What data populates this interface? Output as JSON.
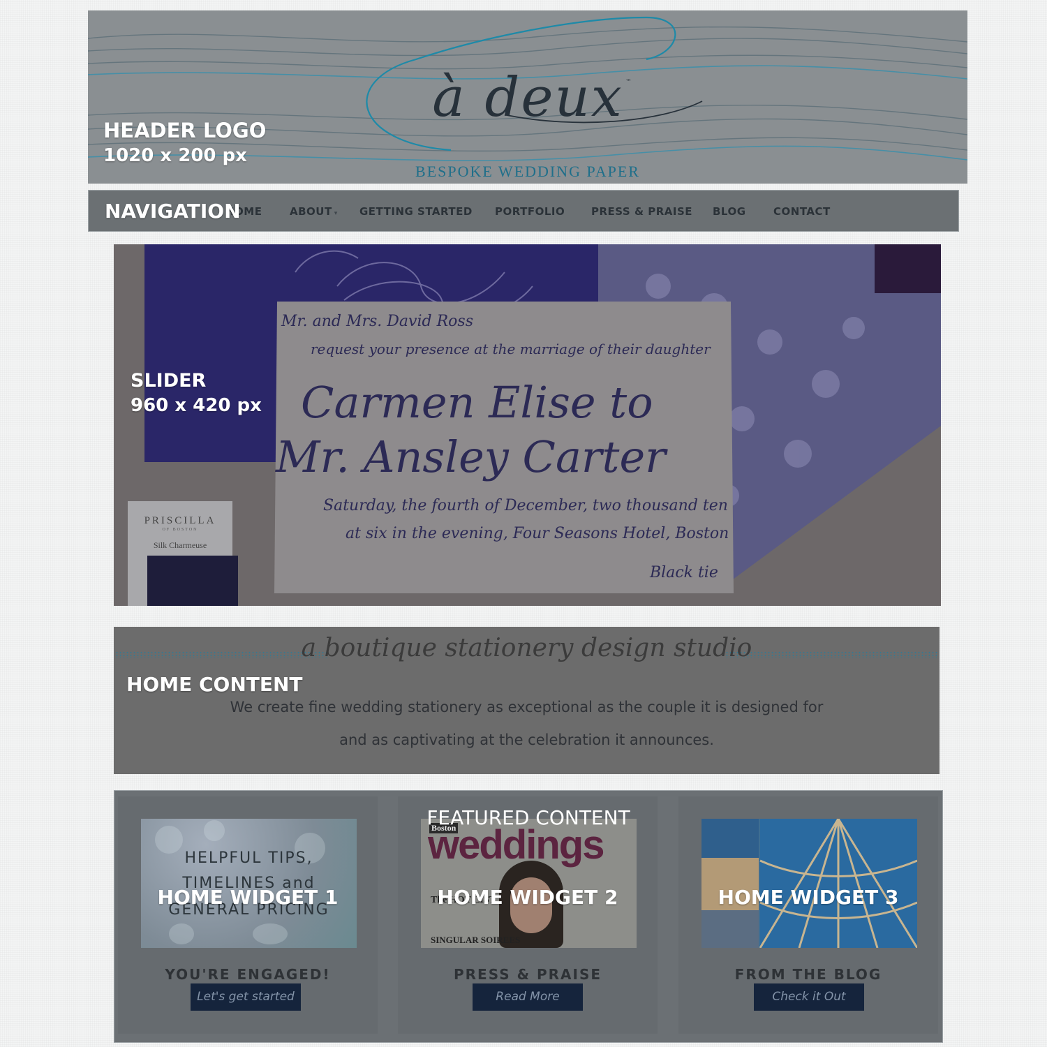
{
  "header": {
    "logo_text": "à deux",
    "logo_tm": "™",
    "tagline": "BESPOKE WEDDING PAPER",
    "label_title": "HEADER LOGO",
    "label_size": "1020 x 200 px"
  },
  "nav": {
    "label": "NAVIGATION",
    "items": [
      "HOME",
      "ABOUT",
      "GETTING STARTED",
      "PORTFOLIO",
      "PRESS & PRAISE",
      "BLOG",
      "CONTACT"
    ],
    "about_caret": "▾"
  },
  "slider": {
    "label_title": "SLIDER",
    "label_size": "960 x 420 px",
    "invitation": {
      "line1": "Mr. and Mrs. David Ross",
      "line2": "request your presence at the marriage of their daughter",
      "line3": "Carmen Elise to",
      "line4": "Mr. Ansley Carter",
      "line5": "Saturday, the fourth of December, two thousand ten",
      "line6": "at six in the evening, Four Seasons Hotel, Boston",
      "line7": "Black tie"
    },
    "swatch": {
      "brand": "PRISCILLA",
      "sub": "OF BOSTON",
      "name": "Silk Charmeuse"
    }
  },
  "home_content": {
    "tagline": "a boutique stationery design studio",
    "label": "HOME CONTENT",
    "line1": "We create fine wedding stationery as exceptional as the couple it is designed for",
    "line2": "and as captivating at the celebration it announces."
  },
  "featured": {
    "label": "FEATURED CONTENT",
    "widgets": [
      {
        "label": "HOME WIDGET 1",
        "image_lines": [
          "HELPFUL TIPS,",
          "TIMELINES and",
          "GENERAL PRICING"
        ],
        "title": "YOU'RE ENGAGED!",
        "button": "Let's get started"
      },
      {
        "label": "HOME WIDGET 2",
        "image_mast": "weddings",
        "image_city": "Boston",
        "image_side": "The HOT LIST",
        "image_side2": "SINGULAR SOIREES",
        "title": "PRESS & PRAISE",
        "button": "Read More"
      },
      {
        "label": "HOME WIDGET 3",
        "title": "FROM THE BLOG",
        "button": "Check it Out"
      }
    ]
  },
  "colors": {
    "overlay_text": "#ffffff",
    "accent_teal": "#1f6f8a",
    "button_navy": "#15243c"
  }
}
